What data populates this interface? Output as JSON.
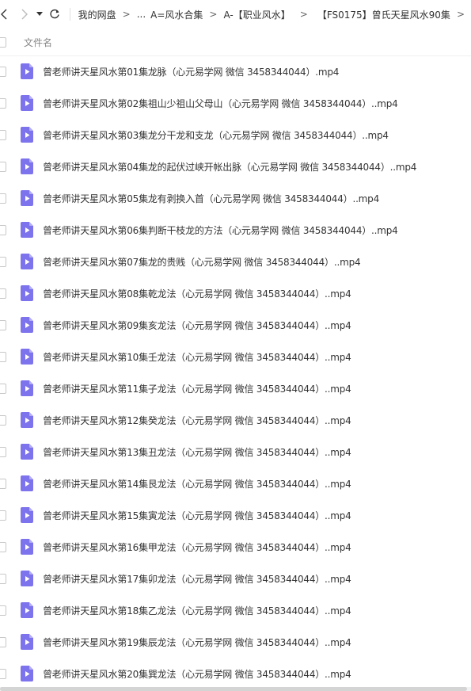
{
  "toolbar": {
    "icons": {
      "back": "chevron-left-icon",
      "forward": "chevron-right-icon",
      "dropdown": "caret-down-icon",
      "refresh": "refresh-icon"
    },
    "breadcrumb": {
      "root": "我的网盘",
      "ellipsis": "...",
      "level1": "A=风水合集",
      "level2": "A-【职业风水】",
      "current": "【FS0175】曾氏天星风水90集",
      "separator": ">"
    }
  },
  "list_header": {
    "name_column": "文件名"
  },
  "files": [
    {
      "name": "曾老师讲天星风水第01集龙脉（心元易学网 微信 3458344044）.mp4"
    },
    {
      "name": "曾老师讲天星风水第02集祖山少祖山父母山（心元易学网 微信 3458344044）..mp4"
    },
    {
      "name": "曾老师讲天星风水第03集龙分干龙和支龙（心元易学网 微信 3458344044）..mp4"
    },
    {
      "name": "曾老师讲天星风水第04集龙的起伏过峡开帐出脉（心元易学网 微信 3458344044）..mp4"
    },
    {
      "name": "曾老师讲天星风水第05集龙有剥换入首（心元易学网 微信 3458344044）..mp4"
    },
    {
      "name": "曾老师讲天星风水第06集判断干枝龙的方法（心元易学网 微信 3458344044）..mp4"
    },
    {
      "name": "曾老师讲天星风水第07集龙的贵贱（心元易学网 微信 3458344044）..mp4"
    },
    {
      "name": "曾老师讲天星风水第08集乾龙法（心元易学网 微信 3458344044）..mp4"
    },
    {
      "name": "曾老师讲天星风水第09集亥龙法（心元易学网 微信 3458344044）..mp4"
    },
    {
      "name": "曾老师讲天星风水第10集壬龙法（心元易学网 微信 3458344044）..mp4"
    },
    {
      "name": "曾老师讲天星风水第11集子龙法（心元易学网 微信 3458344044）..mp4"
    },
    {
      "name": "曾老师讲天星风水第12集癸龙法（心元易学网 微信 3458344044）..mp4"
    },
    {
      "name": "曾老师讲天星风水第13集丑龙法（心元易学网 微信 3458344044）..mp4"
    },
    {
      "name": "曾老师讲天星风水第14集艮龙法（心元易学网 微信 3458344044）..mp4"
    },
    {
      "name": "曾老师讲天星风水第15集寅龙法（心元易学网 微信 3458344044）..mp4"
    },
    {
      "name": "曾老师讲天星风水第16集甲龙法（心元易学网 微信 3458344044）..mp4"
    },
    {
      "name": "曾老师讲天星风水第17集卯龙法（心元易学网 微信 3458344044）..mp4"
    },
    {
      "name": "曾老师讲天星风水第18集乙龙法（心元易学网 微信 3458344044）..mp4"
    },
    {
      "name": "曾老师讲天星风水第19集辰龙法（心元易学网 微信 3458344044）..mp4"
    },
    {
      "name": "曾老师讲天星风水第20集巽龙法（心元易学网 微信 3458344044）..mp4"
    }
  ],
  "file_icon": "video-file-icon",
  "colors": {
    "file_icon": "#7d73ec",
    "file_icon_play": "#ffffff",
    "text": "#333333",
    "muted": "#888888"
  }
}
